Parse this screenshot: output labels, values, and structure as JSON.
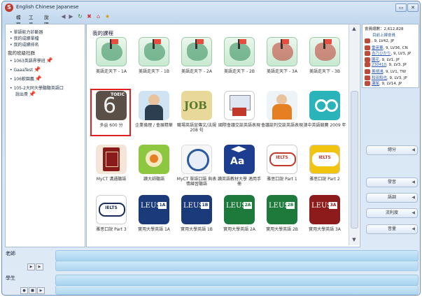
{
  "window": {
    "title": "English Chinese Japanese",
    "logo_text": "S"
  },
  "titlebar_buttons": {
    "minimize": "▭",
    "close": "✕"
  },
  "menu": {
    "items": [
      "檔案",
      "工具",
      "說明"
    ]
  },
  "toolbar": {
    "icons": [
      "back-icon",
      "forward-icon",
      "refresh-icon",
      "stop-icon",
      "home-icon",
      "favorites-icon"
    ]
  },
  "left_panel": {
    "links": [
      "單語能力診斷器",
      "我的成績單檔",
      "我的成績排名"
    ],
    "heading": "我的班級社群",
    "groups": [
      {
        "label": "1063英語界學班",
        "pin": "📌"
      },
      {
        "label": "GaaaTest",
        "pin": "📌"
      },
      {
        "label": "106軟園義",
        "pin": "📌"
      },
      {
        "label": "105-2大同大學聽聽英語口",
        "pin": ""
      },
      {
        "label": "說出貴",
        "pin": "📌"
      }
    ]
  },
  "courses": {
    "title": "我的課程",
    "tiles": [
      {
        "label": "美語走天下 - 1A",
        "kind": "map"
      },
      {
        "label": "美語走天下 - 1B",
        "kind": "map"
      },
      {
        "label": "美語走天下 - 2A",
        "kind": "map"
      },
      {
        "label": "美語走天下 - 2B",
        "kind": "map"
      },
      {
        "label": "美語走天下 - 3A",
        "kind": "mapred"
      },
      {
        "label": "美語走天下 - 3B",
        "kind": "mapred"
      },
      {
        "label": "多益 600 分",
        "kind": "toeic",
        "icon_text": "TOEIC",
        "digit": "6"
      },
      {
        "label": "企業倫理 / 會展精華",
        "kind": "person"
      },
      {
        "label": "職場英語宣傳文/法規 208 句",
        "kind": "job",
        "icon_text": "JOB"
      },
      {
        "label": "國際會議交談英語表現",
        "kind": "meeting"
      },
      {
        "label": "會議談判交談英語表現",
        "kind": "meeting2"
      },
      {
        "label": "澳中英語競賽 2009 年",
        "kind": "owl"
      },
      {
        "label": "MyCT 溝通聽語",
        "kind": "dict"
      },
      {
        "label": "讀大師聽語",
        "kind": "hands"
      },
      {
        "label": "MyCT 單語口語 與表情練習聽語",
        "kind": "seal"
      },
      {
        "label": "讀英語教材大學 適用手冊",
        "kind": "aa",
        "icon_text": "Aa"
      },
      {
        "label": "雅思口說 Part 1",
        "kind": "ielts",
        "icon_text": "IELTS"
      },
      {
        "label": "雅思口說 Part 2",
        "kind": "ielts2",
        "icon_text": "IELTS"
      },
      {
        "label": "雅思口說 Part 3",
        "kind": "ielts3",
        "icon_text": "IELTS"
      },
      {
        "label": "實用大學英語 1A",
        "kind": "leus",
        "icon_text": "LEUS",
        "badge": "1A"
      },
      {
        "label": "實用大學英語 1B",
        "kind": "leus",
        "icon_text": "LEUS",
        "badge": "1B"
      },
      {
        "label": "實用大學英語 2A",
        "kind": "leusg",
        "icon_text": "LEUS",
        "badge": "2A"
      },
      {
        "label": "實用大學英語 2B",
        "kind": "leusg",
        "icon_text": "LEUS",
        "badge": "2B"
      },
      {
        "label": "實用大學英語 3A",
        "kind": "leusr",
        "icon_text": "LEUS",
        "badge": "3A"
      }
    ]
  },
  "right_panel": {
    "stats": "會員總數：2,612,828",
    "online_title": "目前上線會員",
    "users": [
      {
        "name": "",
        "info": "9, LV42, JP"
      },
      {
        "name": "雷英華",
        "info": "9, LV36, CN"
      },
      {
        "name": "吉乃ひかり",
        "info": "9, LV3, JP"
      },
      {
        "name": "園花",
        "info": "9, LV1, JP"
      },
      {
        "name": "230410",
        "info": "9, LV3, JP"
      },
      {
        "name": "黃靖鴻",
        "info": "9, LV1, TW"
      },
      {
        "name": "和田和也",
        "info": "9, LV3, JP"
      },
      {
        "name": "瀬尾",
        "info": "9, LV14, JP"
      }
    ]
  },
  "right_buttons": [
    "總分",
    "發音",
    "語調",
    "流利度",
    "音量"
  ],
  "bottom": {
    "teacher_label": "老師",
    "student_label": "學生"
  },
  "colors": {
    "selected_border": "#e02020",
    "accent": "#2455b5"
  }
}
